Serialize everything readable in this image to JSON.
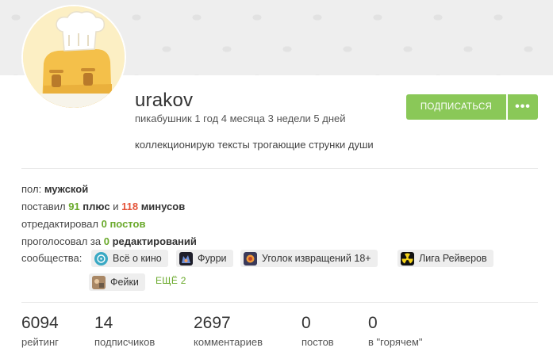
{
  "profile": {
    "username": "urakov",
    "tenure": "пикабушник 1 год 4 месяца 3 недели 5 дней",
    "about": "коллекционирую тексты трогающие струнки души"
  },
  "actions": {
    "subscribe_label": "подписаться",
    "more_label": "•••"
  },
  "info": {
    "gender_label": "пол:",
    "gender_value": "мужской",
    "votes_prefix": "поставил",
    "plus_count": "91",
    "plus_word": "плюс",
    "votes_and": "и",
    "minus_count": "118",
    "minus_word": "минусов",
    "edited_label": "отредактировал",
    "edited_value": "0 постов",
    "voted_edits_label": "проголосовал за",
    "voted_edits_count": "0",
    "voted_edits_word": "редактирований",
    "communities_label": "сообщества:"
  },
  "communities": [
    {
      "name": "Всё о кино",
      "icon": "film-icon"
    },
    {
      "name": "Фурри",
      "icon": "furry-icon"
    },
    {
      "name": "Уголок извращений 18+",
      "icon": "corner-icon"
    },
    {
      "name": "Лига Рейверов",
      "icon": "radiation-icon"
    },
    {
      "name": "Фейки",
      "icon": "fakes-icon"
    }
  ],
  "communities_more": "ЕЩЁ 2",
  "stats": [
    {
      "value": "6094",
      "label": "рейтинг"
    },
    {
      "value": "14",
      "label": "подписчиков"
    },
    {
      "value": "2697",
      "label": "комментариев"
    },
    {
      "value": "0",
      "label": "постов"
    },
    {
      "value": "0",
      "label": "в \"горячем\""
    }
  ],
  "colors": {
    "accent_green": "#8ac858",
    "plus_green": "#6aa92b",
    "minus_red": "#e4543a"
  }
}
